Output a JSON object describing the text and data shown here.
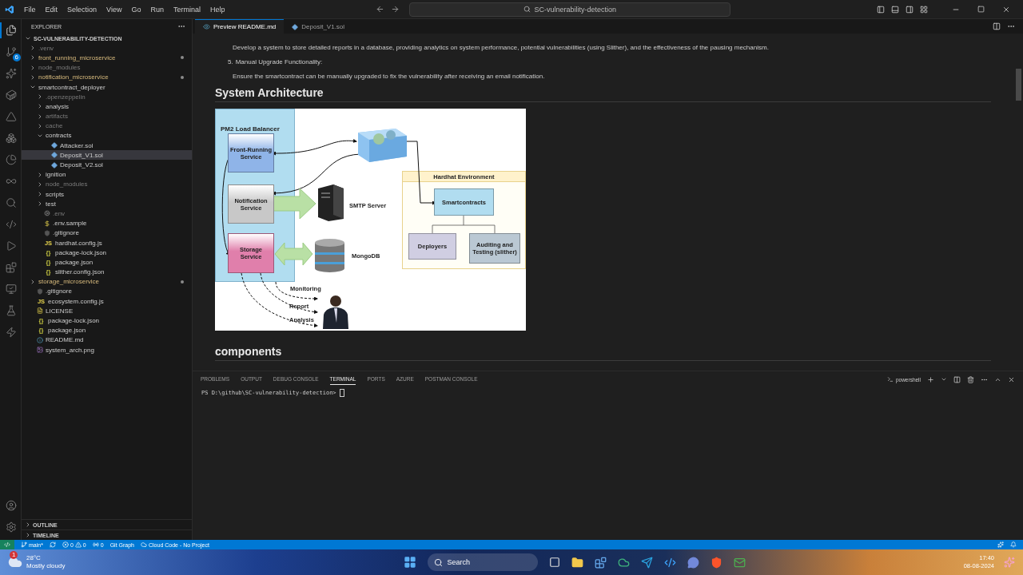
{
  "title_bar": {
    "menu": [
      "File",
      "Edit",
      "Selection",
      "View",
      "Go",
      "Run",
      "Terminal",
      "Help"
    ],
    "search": "SC-vulnerability-detection"
  },
  "activity_bar": {
    "items": [
      {
        "kind": "explorer",
        "selected": true
      },
      {
        "kind": "source-control",
        "selected": false,
        "badge": "6"
      },
      {
        "kind": "sparkle",
        "selected": false
      },
      {
        "kind": "docker",
        "selected": false
      },
      {
        "kind": "azure",
        "selected": false
      },
      {
        "kind": "remote",
        "selected": false
      },
      {
        "kind": "pie",
        "selected": false
      },
      {
        "kind": "infinity",
        "selected": false
      },
      {
        "kind": "search",
        "selected": false
      },
      {
        "kind": "code",
        "selected": false
      },
      {
        "kind": "debug",
        "selected": false
      },
      {
        "kind": "extensions",
        "selected": false
      },
      {
        "kind": "monitor",
        "selected": false
      },
      {
        "kind": "testing",
        "selected": false
      },
      {
        "kind": "zap",
        "selected": false
      }
    ]
  },
  "sidebar": {
    "title": "EXPLORER",
    "root": "SC-VULNERABILITY-DETECTION",
    "tree": [
      {
        "name": ".venv",
        "kind": "folder",
        "expanded": false,
        "modified": false,
        "dimmed": true,
        "selected": false
      },
      {
        "name": "front_running_microservice",
        "kind": "folder",
        "expanded": false,
        "modified": true,
        "dimmed": false,
        "selected": false
      },
      {
        "name": "node_modules",
        "kind": "folder",
        "expanded": false,
        "modified": false,
        "dimmed": true,
        "selected": false
      },
      {
        "name": "notification_microservice",
        "kind": "folder",
        "expanded": false,
        "modified": true,
        "dimmed": false,
        "selected": false
      },
      {
        "name": "smartcontract_deployer",
        "kind": "folder",
        "expanded": true,
        "modified": false,
        "dimmed": false,
        "selected": false,
        "children": [
          {
            "name": ".openzeppelin",
            "kind": "folder",
            "expanded": false,
            "modified": false,
            "dimmed": true,
            "selected": false
          },
          {
            "name": "analysis",
            "kind": "folder",
            "expanded": false,
            "modified": false,
            "dimmed": false,
            "selected": false
          },
          {
            "name": "artifacts",
            "kind": "folder",
            "expanded": false,
            "modified": false,
            "dimmed": true,
            "selected": false
          },
          {
            "name": "cache",
            "kind": "folder",
            "expanded": false,
            "modified": false,
            "dimmed": true,
            "selected": false
          },
          {
            "name": "contracts",
            "kind": "folder",
            "expanded": true,
            "modified": false,
            "dimmed": false,
            "selected": false,
            "children": [
              {
                "name": "Attacker.sol",
                "kind": "sol",
                "dimmed": false,
                "selected": false
              },
              {
                "name": "Deposit_V1.sol",
                "kind": "sol",
                "dimmed": false,
                "selected": true
              },
              {
                "name": "Deposit_V2.sol",
                "kind": "sol",
                "dimmed": false,
                "selected": false
              }
            ]
          },
          {
            "name": "ignition",
            "kind": "folder",
            "expanded": false,
            "modified": false,
            "dimmed": false,
            "selected": false
          },
          {
            "name": "node_modules",
            "kind": "folder",
            "expanded": false,
            "modified": false,
            "dimmed": true,
            "selected": false
          },
          {
            "name": "scripts",
            "kind": "folder",
            "expanded": false,
            "modified": false,
            "dimmed": false,
            "selected": false
          },
          {
            "name": "test",
            "kind": "folder",
            "expanded": false,
            "modified": false,
            "dimmed": false,
            "selected": false
          },
          {
            "name": ".env",
            "kind": "gear",
            "dimmed": true,
            "selected": false
          },
          {
            "name": ".env.sample",
            "kind": "dollar",
            "dimmed": false,
            "selected": false
          },
          {
            "name": ".gitignore",
            "kind": "git",
            "dimmed": false,
            "selected": false
          },
          {
            "name": "hardhat.config.js",
            "kind": "js",
            "glyph": "JS",
            "dimmed": false,
            "selected": false
          },
          {
            "name": "package-lock.json",
            "kind": "json",
            "glyph": "{}",
            "dimmed": false,
            "selected": false
          },
          {
            "name": "package.json",
            "kind": "json",
            "glyph": "{}",
            "dimmed": false,
            "selected": false
          },
          {
            "name": "slither.config.json",
            "kind": "json",
            "glyph": "{}",
            "dimmed": false,
            "selected": false
          }
        ]
      },
      {
        "name": "storage_microservice",
        "kind": "folder",
        "expanded": false,
        "modified": true,
        "dimmed": false,
        "selected": false
      },
      {
        "name": ".gitignore",
        "kind": "git",
        "dimmed": false,
        "selected": false
      },
      {
        "name": "ecosystem.config.js",
        "kind": "js",
        "glyph": "JS",
        "dimmed": false,
        "selected": false
      },
      {
        "name": "LICENSE",
        "kind": "license",
        "dimmed": false,
        "selected": false
      },
      {
        "name": "package-lock.json",
        "kind": "json",
        "glyph": "{}",
        "dimmed": false,
        "selected": false
      },
      {
        "name": "package.json",
        "kind": "json",
        "glyph": "{}",
        "dimmed": false,
        "selected": false
      },
      {
        "name": "README.md",
        "kind": "info",
        "dimmed": false,
        "selected": false
      },
      {
        "name": "system_arch.png",
        "kind": "image",
        "dimmed": false,
        "selected": false
      }
    ],
    "sections": [
      {
        "title": "OUTLINE",
        "expanded": false
      },
      {
        "title": "TIMELINE",
        "expanded": false
      }
    ]
  },
  "tabs": [
    {
      "label": "Preview README.md",
      "kind": "preview",
      "selected": true
    },
    {
      "label": "Deposit_V1.sol",
      "kind": "sol",
      "selected": false
    }
  ],
  "preview": {
    "blocks": [
      {
        "kind": "para",
        "text": "Develop a system to store detailed reports in a database, providing analytics on system performance, potential vulnerabilities (using Slither), and the effectiveness of the pausing mechanism."
      },
      {
        "kind": "item",
        "number": "5.",
        "text": "Manual Upgrade Functionality:"
      },
      {
        "kind": "para",
        "text": "Ensure the smartcontract can be manually upgraded to fix the vulnerability after receiving an email notification."
      },
      {
        "kind": "heading",
        "text": "System Architecture"
      },
      {
        "kind": "diagram"
      },
      {
        "kind": "heading",
        "text": "components"
      }
    ],
    "diagram": {
      "nodes": [
        {
          "kind": "container",
          "text": "PM2 Load Balancer"
        },
        {
          "kind": "service",
          "text": "Front-Running Service",
          "color": "#8fb4e8"
        },
        {
          "kind": "service",
          "text": "Notification Service",
          "color": "#c8c8c8"
        },
        {
          "kind": "service",
          "text": "Storage Service",
          "color": "#e07fab"
        },
        {
          "kind": "label",
          "text": "SMTP Server"
        },
        {
          "kind": "label",
          "text": "MongoDB"
        },
        {
          "kind": "group",
          "text": "Hardhat Environment"
        },
        {
          "kind": "box",
          "text": "Smartcontracts",
          "color": "#b1ddf0"
        },
        {
          "kind": "box",
          "text": "Deployers",
          "color": "#d0cee2"
        },
        {
          "kind": "box",
          "text": "Auditing and Testing (slither)",
          "color": "#bac8d3"
        },
        {
          "kind": "label",
          "text": "Monitoring"
        },
        {
          "kind": "label",
          "text": "Report"
        },
        {
          "kind": "label",
          "text": "Analysis"
        }
      ]
    }
  },
  "panel": {
    "tabs": [
      {
        "label": "PROBLEMS",
        "selected": false
      },
      {
        "label": "OUTPUT",
        "selected": false
      },
      {
        "label": "DEBUG CONSOLE",
        "selected": false
      },
      {
        "label": "TERMINAL",
        "selected": true
      },
      {
        "label": "PORTS",
        "selected": false
      },
      {
        "label": "AZURE",
        "selected": false
      },
      {
        "label": "POSTMAN CONSOLE",
        "selected": false
      }
    ],
    "shell": "powershell",
    "prompt": "PS D:\\github\\SC-vulnerability-detection>"
  },
  "status_bar": {
    "branch": "main*",
    "errors": "0",
    "warnings": "0",
    "ports": "0",
    "items": [
      "Git Graph",
      "Cloud Code - No Project"
    ]
  },
  "taskbar": {
    "weather": {
      "temp": "28°C",
      "text": "Mostly cloudy",
      "badge": "1"
    },
    "search": "Search",
    "time": "17:40",
    "date": "08-08-2024"
  }
}
